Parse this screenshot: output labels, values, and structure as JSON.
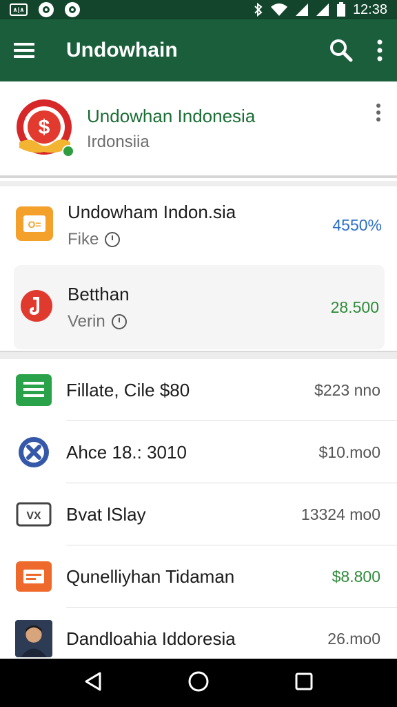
{
  "status_bar": {
    "time": "12:38",
    "left_badge": "∧|∧"
  },
  "app_bar": {
    "title": "Undowhain"
  },
  "profile": {
    "name": "Undowhan Indonesia",
    "subtitle": "Irdonsiia"
  },
  "cards": [
    {
      "title": "Undowham Indon.sia",
      "subtitle": "Fike",
      "value": "4550%",
      "value_color": "#2b6fc6"
    },
    {
      "title": "Betthan",
      "subtitle": "Verin",
      "value": "28.500",
      "value_color": "#2e8b3a"
    }
  ],
  "list": [
    {
      "title": "Fillate, Cile $80",
      "value": "$223 nno",
      "icon": "green-doc-icon",
      "value_color": "#555555"
    },
    {
      "title": "Ahce 18.: 3010",
      "value": "$10.mo0",
      "icon": "blue-cross-icon",
      "value_color": "#555555"
    },
    {
      "title": "Bvat lSlay",
      "value": "13324 mo0",
      "icon": "vx-badge-icon",
      "value_color": "#555555"
    },
    {
      "title": "Qunelliyhan Tidaman",
      "value": "$8.800",
      "icon": "orange-card-icon",
      "value_color": "#2e8b3a"
    },
    {
      "title": "Dandloahia Iddoresia",
      "value": "26.mo0",
      "icon": "person-photo-icon",
      "value_color": "#555555"
    }
  ],
  "colors": {
    "app_bar": "#1b5e3b",
    "status_bar": "#12452c",
    "accent_green": "#2e8b3a",
    "accent_blue": "#2b6fc6"
  }
}
